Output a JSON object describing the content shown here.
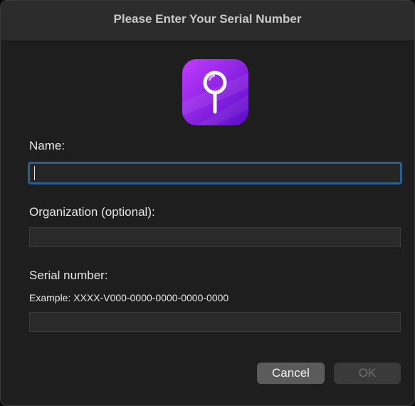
{
  "window": {
    "title": "Please Enter Your Serial Number"
  },
  "app_icon": {
    "icon": "magnifier-icon",
    "colors": [
      "#a51dff",
      "#6a0fd9"
    ]
  },
  "form": {
    "name": {
      "label": "Name:",
      "value": ""
    },
    "organization": {
      "label": "Organization (optional):",
      "value": ""
    },
    "serial": {
      "label": "Serial number:",
      "example": "Example: XXXX-V000-0000-0000-0000-0000",
      "value": ""
    }
  },
  "buttons": {
    "cancel": "Cancel",
    "ok": "OK"
  },
  "colors": {
    "focus_ring": "#2b5f8f",
    "window_bg": "#1e1e1e",
    "titlebar_bg": "#2c2c2c"
  }
}
